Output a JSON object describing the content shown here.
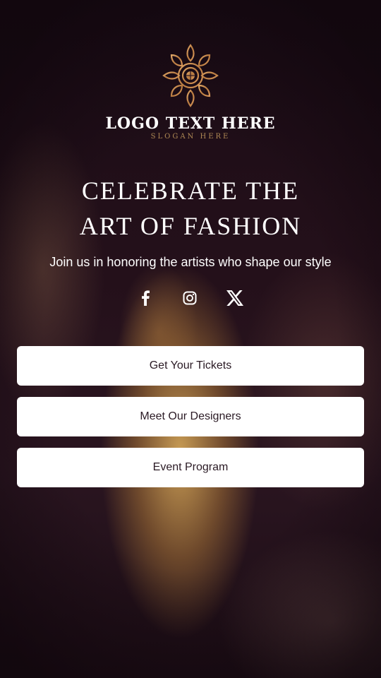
{
  "brand": {
    "logo_text": "LOGO TEXT HERE",
    "slogan": "SLOGAN HERE",
    "logo_icon": "mandala-icon",
    "accent_color": "#c68a4f"
  },
  "hero": {
    "headline_line1": "CELEBRATE THE",
    "headline_line2": "ART OF FASHION",
    "tagline": "Join us in honoring the artists who shape our style"
  },
  "socials": [
    {
      "icon": "facebook-icon"
    },
    {
      "icon": "instagram-icon"
    },
    {
      "icon": "x-icon"
    }
  ],
  "buttons": [
    {
      "label": "Get Your Tickets"
    },
    {
      "label": "Meet Our Designers"
    },
    {
      "label": "Event Program"
    }
  ],
  "colors": {
    "button_bg": "#ffffff",
    "button_text": "#2a1a24",
    "text": "#ffffff"
  }
}
